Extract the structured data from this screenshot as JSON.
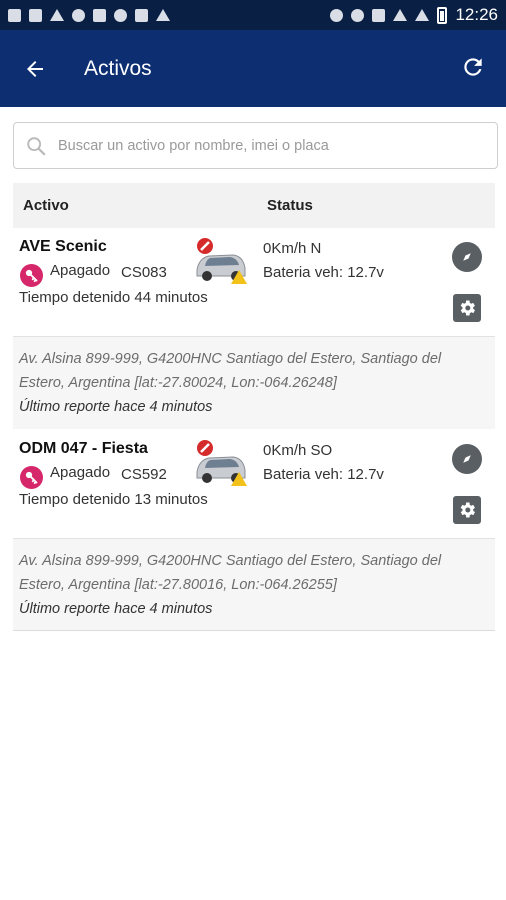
{
  "statusbar": {
    "time": "12:26",
    "left_icons": [
      "facebook-icon",
      "mail-icon",
      "send-icon",
      "whatsapp-icon",
      "gallery-icon",
      "block-icon",
      "car-icon",
      "flag-icon"
    ],
    "right_icons": [
      "location-icon",
      "alarm-icon",
      "bluetooth-icon",
      "wifi-icon",
      "signal-icon",
      "battery-icon"
    ]
  },
  "appbar": {
    "title": "Activos",
    "back_icon": "back-arrow-icon",
    "refresh_icon": "refresh-icon"
  },
  "search": {
    "placeholder": "Buscar un activo por nombre, imei o placa",
    "value": ""
  },
  "table": {
    "headers": [
      "Activo",
      "Status"
    ]
  },
  "assets": [
    {
      "name": "AVE Scenic",
      "state": "Apagado",
      "plate": "CS083",
      "stopped": "Tiempo detenido 44 minutos",
      "speed": "0Km/h N",
      "battery": "Bateria veh: 12.7v",
      "address": "Av. Alsina 899-999, G4200HNC Santiago del Estero, Santiago del Estero, Argentina [lat:-27.80024, Lon:-064.26248]",
      "last_report": "Último reporte hace 4 minutos"
    },
    {
      "name": "ODM 047 - Fiesta",
      "state": "Apagado",
      "plate": "CS592",
      "stopped": "Tiempo detenido 13 minutos",
      "speed": "0Km/h SO",
      "battery": "Bateria veh: 12.7v",
      "address": "Av. Alsina 899-999, G4200HNC Santiago del Estero, Santiago del Estero, Argentina [lat:-27.80016, Lon:-064.26255]",
      "last_report": "Último reporte hace 4 minutos"
    }
  ],
  "colors": {
    "appbar": "#0d2f72",
    "statusbar": "#0a1f44",
    "key_badge": "#d6276a",
    "warning": "#f2c21b",
    "action_icon": "#5a5f64"
  }
}
